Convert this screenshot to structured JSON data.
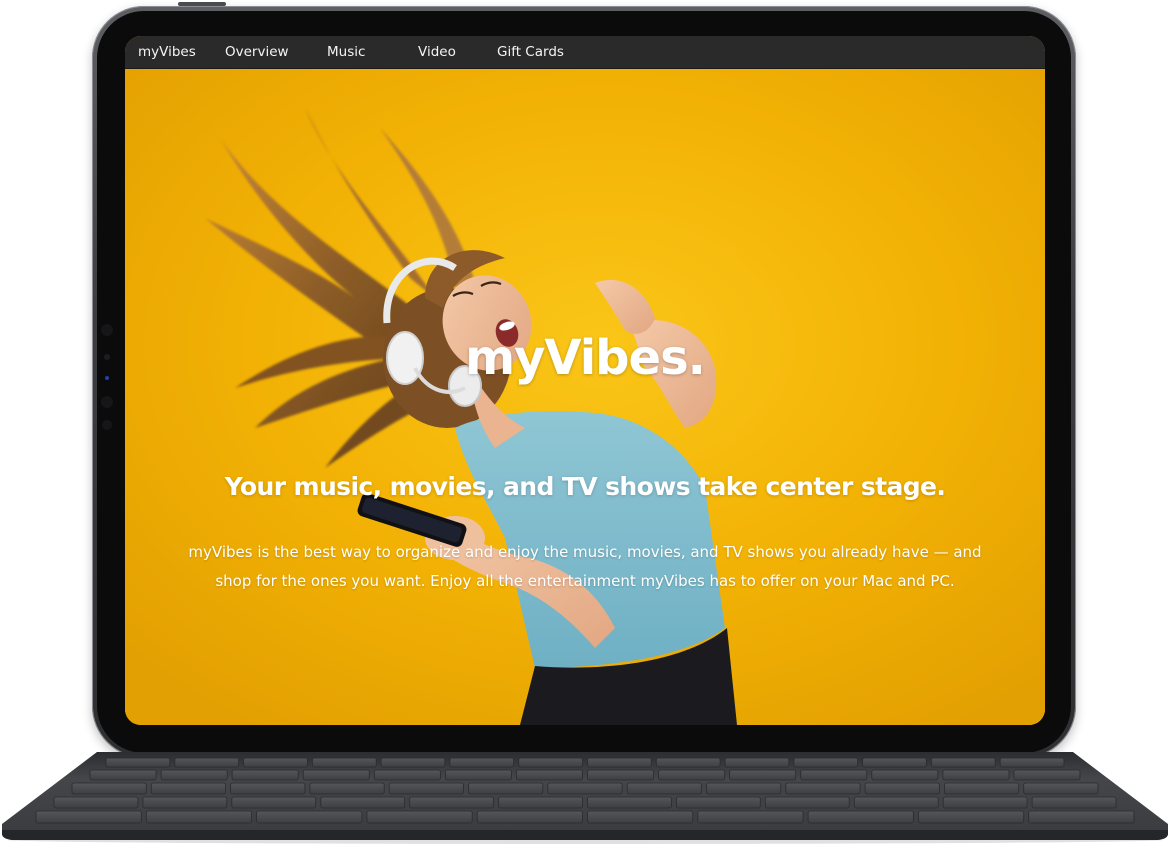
{
  "navbar": {
    "items": [
      {
        "label": "myVibes"
      },
      {
        "label": "Overview"
      },
      {
        "label": "Music"
      },
      {
        "label": "Video"
      },
      {
        "label": "Gift Cards"
      }
    ]
  },
  "hero": {
    "brand": "myVibes.",
    "heading": "Your music, movies, and TV shows take center stage.",
    "body_line1": "myVibes is the best way to organize and enjoy the music, movies, and TV shows you already have — and",
    "body_line2": "shop for the ones you want. Enjoy all the entertainment myVibes has to offer on your Mac and PC.",
    "image": "woman-dancing-with-headphones-photo"
  },
  "colors": {
    "hero_background": "#f2b103",
    "navbar_background": "#2a2a2b",
    "navbar_text": "#f4f4f4",
    "device_frame": "#3c3d40",
    "keyboard": "#3a3b3e"
  }
}
